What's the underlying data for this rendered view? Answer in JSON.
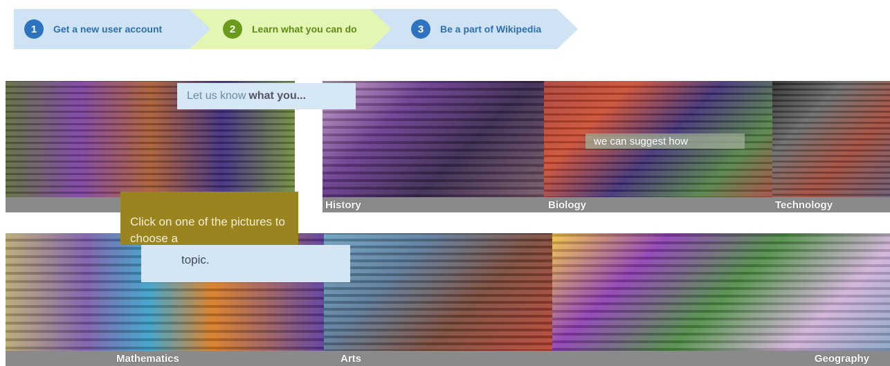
{
  "steps": [
    {
      "number": "1",
      "label": "Get a new user account"
    },
    {
      "number": "2",
      "label": "Learn what you can do"
    },
    {
      "number": "3",
      "label": "Be a part of Wikipedia"
    }
  ],
  "intro": {
    "ask_text": "Let us know",
    "ask_bold": "what you...",
    "suggest_text": "we can suggest how"
  },
  "hint": {
    "text": "Click on one of the pictures to choose a",
    "tail": "topic."
  },
  "topics": {
    "history": "History",
    "biology": "Biology",
    "technology": "Technology",
    "mathematics": "Mathematics",
    "arts": "Arts",
    "geography": "Geography"
  },
  "colors": {
    "step_active_bg": "#e4f6b4",
    "step_inactive_bg": "#cfe3f5",
    "step_blue": "#2d73c0",
    "step_green": "#6b9b1a",
    "hint_bg": "#9a8420"
  }
}
